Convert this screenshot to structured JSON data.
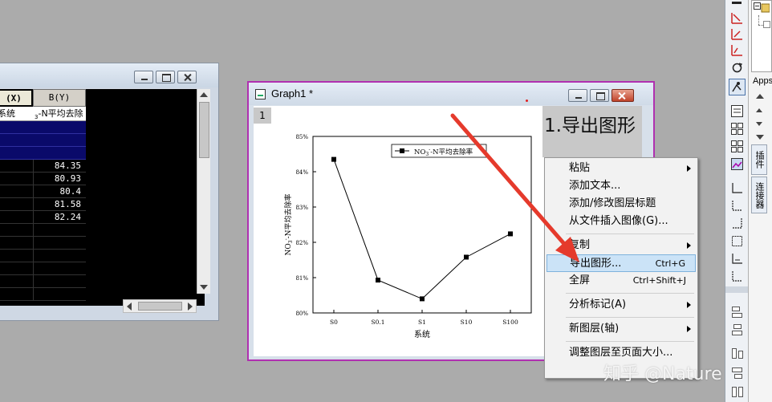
{
  "worksheet": {
    "col_a_header": "(X)",
    "col_b_header": "B(Y)",
    "col_a_longname": "系统",
    "col_b_longname": "-N平均去除",
    "col_b_longname_sub": "3",
    "values": [
      "84.35",
      "80.93",
      "80.4",
      "81.58",
      "82.24"
    ]
  },
  "graph_window": {
    "title": "Graph1 *",
    "layer_number": "1",
    "annotation": "1.导出图形"
  },
  "chart_data": {
    "type": "line",
    "categories": [
      "S0",
      "S0.1",
      "S1",
      "S10",
      "S100"
    ],
    "series": [
      {
        "name": "NO3--N平均去除率",
        "values": [
          84.35,
          80.93,
          80.4,
          81.58,
          82.24
        ]
      }
    ],
    "legend_text": "NO",
    "legend_sub": "3",
    "legend_sup": "-",
    "legend_rest": "-N平均去除率",
    "xlabel": "系统",
    "ylabel_sub": "3",
    "ylabel_sup": "-",
    "ylabel_prefix": "NO",
    "ylabel_rest": "-N平均去除率",
    "yticks": [
      "80%",
      "81%",
      "82%",
      "83%",
      "84%",
      "85%"
    ],
    "ylim": [
      80,
      85
    ],
    "grid": false,
    "legend_position": "top-right",
    "marker": "square",
    "color": "#000000"
  },
  "context_menu": {
    "items": [
      {
        "label": "粘贴",
        "shortcut": "",
        "submenu": true
      },
      {
        "label": "添加文本...",
        "shortcut": "",
        "submenu": false
      },
      {
        "label": "添加/修改图层标题",
        "shortcut": "",
        "submenu": false
      },
      {
        "label": "从文件插入图像(G)...",
        "shortcut": "",
        "submenu": false
      },
      {
        "label": "复制",
        "shortcut": "",
        "submenu": true
      },
      {
        "label": "导出图形...",
        "shortcut": "Ctrl+G",
        "submenu": false,
        "highlighted": true
      },
      {
        "label": "全屏",
        "shortcut": "Ctrl+Shift+J",
        "submenu": false
      },
      {
        "label": "分析标记(A)",
        "shortcut": "",
        "submenu": true
      },
      {
        "label": "新图层(轴)",
        "shortcut": "",
        "submenu": true
      },
      {
        "label": "调整图层至页面大小...",
        "shortcut": "",
        "submenu": false
      }
    ]
  },
  "right_panel": {
    "apps_label": "Apps",
    "tab_1": "插件",
    "tab_2": "连接器"
  },
  "watermark": "知乎 @Nature",
  "colors": {
    "background": "#ababab",
    "graph_border": "#b030b0",
    "highlight": "#cbe3f7",
    "arrow": "#e53a2c"
  }
}
